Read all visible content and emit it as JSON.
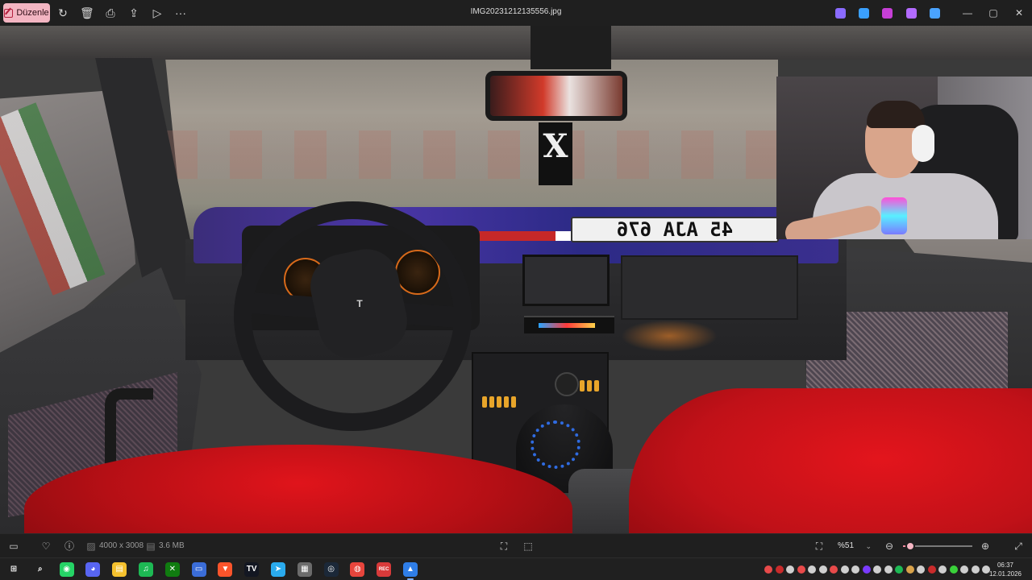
{
  "titlebar": {
    "edit_label": "Düzenle",
    "file_name": "IMG20231212135556.jpg",
    "tools": [
      "rotate-icon",
      "delete-icon",
      "print-icon",
      "share-icon",
      "slideshow-icon",
      "more-icon"
    ],
    "more_label": "···",
    "app_chips": [
      {
        "name": "copilot-icon",
        "color": "#8a6bff"
      },
      {
        "name": "designer-icon",
        "color": "#3aa0ff"
      },
      {
        "name": "clipchamp-icon",
        "color": "#c63fd6"
      },
      {
        "name": "paint-icon",
        "color": "#b36bff"
      },
      {
        "name": "onedrive-icon",
        "color": "#4aa3ff"
      }
    ],
    "window_controls": {
      "minimize": "—",
      "maximize": "▢",
      "close": "✕"
    }
  },
  "photo": {
    "plate_text": "45 AJA 676",
    "hanger_text": "X",
    "wheel_logo": "T"
  },
  "statusbar": {
    "dimensions": "4000 x 3008",
    "file_size": "3.6 MB",
    "zoom_level": "%51",
    "zoom_fraction": 0.1,
    "colors": {
      "accent": "#f28aa0"
    }
  },
  "taskbar": {
    "apps": [
      {
        "name": "start-icon",
        "label": "⊞",
        "color": "#202020"
      },
      {
        "name": "search-icon",
        "label": "⌕",
        "color": "#202020"
      },
      {
        "name": "whatsapp-icon",
        "label": "◉",
        "color": "#25d366"
      },
      {
        "name": "discord-icon",
        "label": "◕",
        "color": "#5865f2"
      },
      {
        "name": "file-explorer-icon",
        "label": "▤",
        "color": "#f5c12e"
      },
      {
        "name": "spotify-icon",
        "label": "♫",
        "color": "#1db954"
      },
      {
        "name": "xbox-icon",
        "label": "✕",
        "color": "#107c10"
      },
      {
        "name": "monitor-icon",
        "label": "▭",
        "color": "#3b6dd8"
      },
      {
        "name": "brave-icon",
        "label": "▼",
        "color": "#fb542b"
      },
      {
        "name": "tradingview-icon",
        "label": "TV",
        "color": "#131722"
      },
      {
        "name": "telegram-icon",
        "label": "➤",
        "color": "#2aabee"
      },
      {
        "name": "calculator-icon",
        "label": "▦",
        "color": "#6b6b6b"
      },
      {
        "name": "steam-icon",
        "label": "◎",
        "color": "#1b2838"
      },
      {
        "name": "chrome-icon",
        "label": "◍",
        "color": "#e8453c"
      },
      {
        "name": "obs-icon",
        "label": "REC",
        "color": "#d83a3a"
      },
      {
        "name": "photos-icon",
        "label": "▲",
        "color": "#2f7ee8"
      }
    ],
    "tray_colors": [
      "#e84a4a",
      "#c92b2b",
      "#cfcfcf",
      "#e84a4a",
      "#cfcfcf",
      "#cfcfcf",
      "#e84a4a",
      "#cfcfcf",
      "#cfcfcf",
      "#7a3bff",
      "#cfcfcf",
      "#cfcfcf",
      "#1db954",
      "#d8a24a",
      "#cfcfcf",
      "#c92b2b",
      "#cfcfcf",
      "#3ad13a",
      "#cfcfcf",
      "#cfcfcf",
      "#cfcfcf"
    ],
    "clock": {
      "time": "06:37",
      "date": "12.01.2026"
    }
  }
}
